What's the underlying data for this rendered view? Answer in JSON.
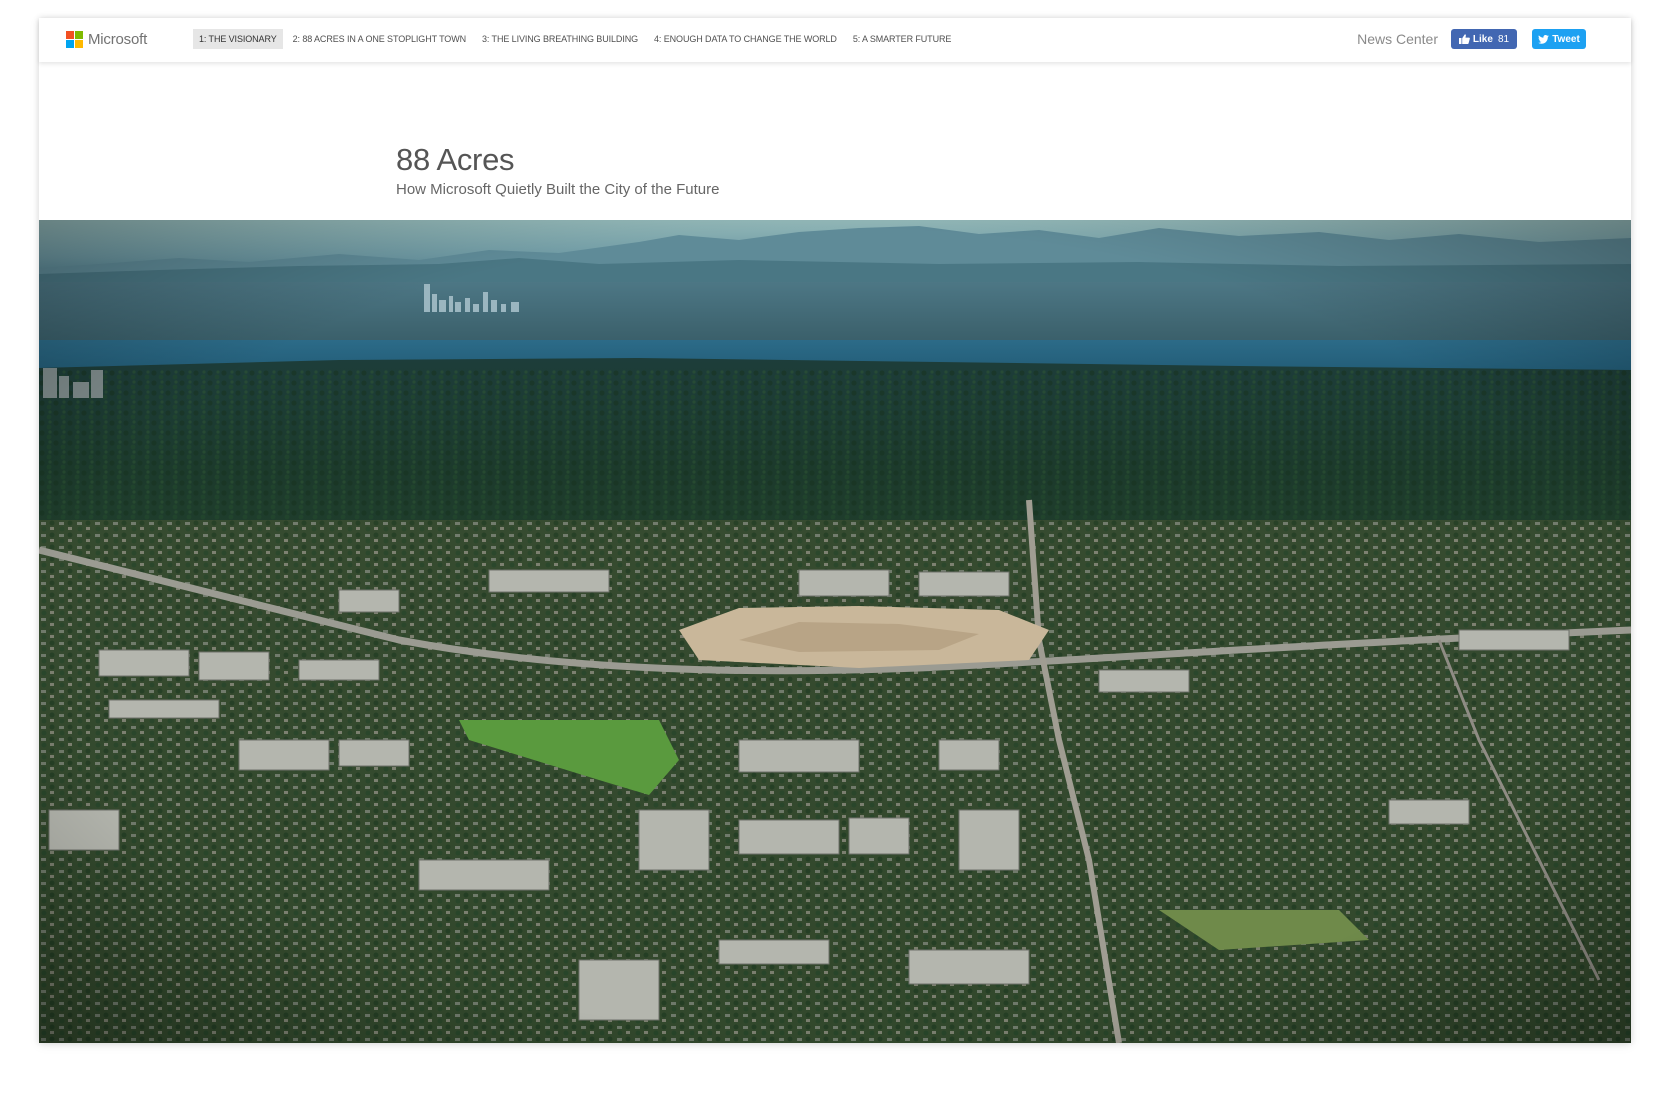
{
  "header": {
    "logo_text": "Microsoft",
    "logo_colors": [
      "#f25022",
      "#7fba00",
      "#00a4ef",
      "#ffb900"
    ],
    "nav_items": [
      {
        "label": "1: The Visionary",
        "active": true
      },
      {
        "label": "2: 88 Acres in a One Stoplight Town",
        "active": false
      },
      {
        "label": "3: The Living Breathing Building",
        "active": false
      },
      {
        "label": "4: Enough Data to Change the World",
        "active": false
      },
      {
        "label": "5: A Smarter Future",
        "active": false
      }
    ],
    "news_center_label": "News Center",
    "like_label": "Like",
    "like_count": "81",
    "tweet_label": "Tweet",
    "like_color": "#4267b2",
    "tweet_color": "#1da1f2"
  },
  "article": {
    "title": "88 Acres",
    "subtitle": "How Microsoft Quietly Built the City of the Future"
  },
  "hero_image": {
    "alt": "Aerial view of the Microsoft campus in Redmond with Lake Washington, the Seattle skyline and the Olympic Mountains in the distance",
    "sky_color": "#6f9aa4",
    "water_color": "#2f6f8c",
    "forest_color": "#1c3a2c"
  }
}
